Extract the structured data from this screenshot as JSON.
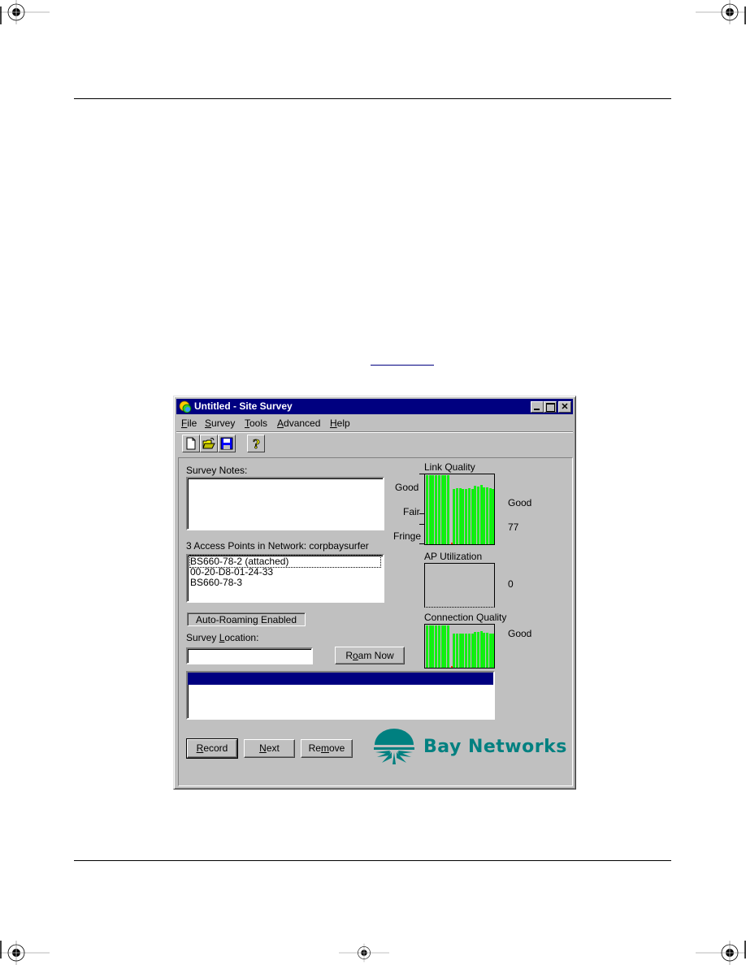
{
  "window": {
    "title": "Untitled - Site Survey",
    "controls": [
      "minimize",
      "maximize",
      "close"
    ]
  },
  "menu": [
    {
      "label": "File",
      "mnemonic": "F",
      "rest": "ile"
    },
    {
      "label": "Survey",
      "mnemonic": "S",
      "rest": "urvey"
    },
    {
      "label": "Tools",
      "mnemonic": "T",
      "rest": "ools"
    },
    {
      "label": "Advanced",
      "mnemonic": "A",
      "rest": "dvanced"
    },
    {
      "label": "Help",
      "mnemonic": "H",
      "rest": "elp"
    }
  ],
  "toolbar": {
    "buttons": [
      "new-file-icon",
      "open-folder-icon",
      "save-disk-icon",
      "help-icon"
    ]
  },
  "survey_notes": {
    "label": "Survey Notes:",
    "value": ""
  },
  "access_points": {
    "label": "3 Access Points in Network: corpbaysurfer",
    "items": [
      "BS660-78-2  (attached)",
      "00-20-D8-01-24-33",
      "BS660-78-3"
    ],
    "selected_index": 0
  },
  "auto_roaming": {
    "label": "Auto-Roaming Enabled"
  },
  "survey_location": {
    "label": "Survey Location:",
    "value": ""
  },
  "buttons": {
    "roam_now": "Roam Now",
    "record": "Record",
    "next": "Next",
    "remove": "Remove"
  },
  "link_quality": {
    "title": "Link Quality",
    "scale_labels": [
      "Good",
      "Fair",
      "Fringe"
    ],
    "status": "Good",
    "value": "77",
    "bars": [
      100,
      100,
      100,
      100,
      100,
      100,
      100,
      100,
      0,
      80,
      81,
      81,
      80,
      80,
      81,
      80,
      85,
      84,
      86,
      82,
      82,
      81,
      80
    ]
  },
  "ap_utilization": {
    "title": "AP Utilization",
    "value": "0"
  },
  "connection_quality": {
    "title": "Connection Quality",
    "status": "Good",
    "bars": [
      100,
      100,
      100,
      100,
      100,
      100,
      100,
      100,
      0,
      80,
      81,
      81,
      80,
      80,
      81,
      80,
      85,
      84,
      86,
      82,
      82,
      81,
      80
    ]
  },
  "survey_log": {
    "rows": [
      ""
    ],
    "selected_index": 0
  },
  "logo": {
    "text": "Bay Networks",
    "color": "#008080"
  },
  "colors": {
    "titlebar": "#000080",
    "window_bg": "#c0c0c0",
    "bar_green": "#00ff00"
  }
}
